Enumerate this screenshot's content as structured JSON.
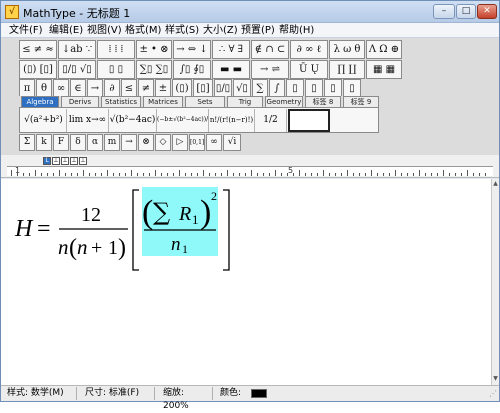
{
  "window": {
    "app_name": "MathType",
    "title_separator": " - ",
    "document_name": "无标题 1"
  },
  "window_buttons": {
    "minimize": "–",
    "maximize": "□",
    "close": "✕"
  },
  "menu": [
    {
      "label": "文件(F)"
    },
    {
      "label": "编辑(E)"
    },
    {
      "label": "视图(V)"
    },
    {
      "label": "格式(M)"
    },
    {
      "label": "样式(S)"
    },
    {
      "label": "大小(Z)"
    },
    {
      "label": "预置(P)"
    },
    {
      "label": "帮助(H)"
    }
  ],
  "palette_row1": [
    {
      "label": "≤ ≠ ≈"
    },
    {
      "label": "↓ab ∵"
    },
    {
      "label": "⁞ ⁞ ⁞"
    },
    {
      "label": "± • ⊗"
    },
    {
      "label": "→ ⇔ ↓"
    },
    {
      "label": "∴ ∀ ∃"
    },
    {
      "label": "∉ ∩ ⊂"
    },
    {
      "label": "∂ ∞ ℓ"
    },
    {
      "label": "λ ω θ"
    },
    {
      "label": "Λ Ω ⊕"
    }
  ],
  "palette_row2": [
    {
      "label": "(▯) [▯]"
    },
    {
      "label": "▯/▯ √▯"
    },
    {
      "label": "▯ ▯"
    },
    {
      "label": "∑▯ ∑▯"
    },
    {
      "label": "∫▯ ∮▯"
    },
    {
      "label": "▬ ▬"
    },
    {
      "label": "→ ⇌"
    },
    {
      "label": "Ū Ų"
    },
    {
      "label": "∏ ∐"
    },
    {
      "label": "▦ ▦"
    }
  ],
  "palette_row3": [
    {
      "label": "π"
    },
    {
      "label": "θ"
    },
    {
      "label": "∞"
    },
    {
      "label": "∈"
    },
    {
      "label": "→"
    },
    {
      "label": "∂"
    },
    {
      "label": "≤"
    },
    {
      "label": "≠"
    },
    {
      "label": "±"
    },
    {
      "label": "(▯)"
    },
    {
      "label": "[▯]"
    },
    {
      "label": "▯/▯"
    },
    {
      "label": "√▯"
    },
    {
      "label": "∑"
    },
    {
      "label": "∫"
    },
    {
      "label": "▯"
    },
    {
      "label": "▯"
    },
    {
      "label": "▯"
    },
    {
      "label": "▯"
    }
  ],
  "template_tabs": [
    {
      "label": "Algebra"
    },
    {
      "label": "Derivs"
    },
    {
      "label": "Statistics"
    },
    {
      "label": "Matrices"
    },
    {
      "label": "Sets"
    },
    {
      "label": "Trig"
    },
    {
      "label": "Geometry"
    },
    {
      "label": "标签 8"
    },
    {
      "label": "标签 9"
    }
  ],
  "templates": [
    {
      "label": "√(a²+b²)"
    },
    {
      "label": "lim x→∞"
    },
    {
      "label": "√(b²−4ac)"
    },
    {
      "label": "(−b±√(b²−4ac))/2a"
    },
    {
      "label": "n!/(r!(n−r)!)"
    },
    {
      "label": "1/2"
    },
    {
      "label": ""
    }
  ],
  "small_buttons": [
    {
      "label": "Σ"
    },
    {
      "label": "k"
    },
    {
      "label": "F"
    },
    {
      "label": "δ"
    },
    {
      "label": "α"
    },
    {
      "label": "m"
    },
    {
      "label": "→"
    },
    {
      "label": "⊗"
    },
    {
      "label": "◇"
    },
    {
      "label": "▷"
    },
    {
      "label": "[0,1]"
    },
    {
      "label": "∞"
    },
    {
      "label": "√i"
    }
  ],
  "ruler": {
    "marks": [
      "1",
      "5"
    ]
  },
  "ruler_tabs": [
    {
      "label": "L"
    },
    {
      "label": "⊥"
    },
    {
      "label": "⊥"
    },
    {
      "label": "⊥"
    },
    {
      "label": "⊥"
    }
  ],
  "equation": {
    "lhs": "H",
    "equals": "=",
    "numerator": "12",
    "den_n": "n",
    "den_paren_open": "(",
    "den_n2": "n",
    "den_plus": "+",
    "den_one": "1",
    "den_paren_close": ")",
    "sum_symbol": "∑",
    "sum_var": "R",
    "sum_sub": "1",
    "exponent": "2",
    "inner_den": "n",
    "inner_den_sub": "1",
    "highlight_color": "#8ff8f8"
  },
  "status": {
    "style": "样式: 数学(M)",
    "size": "尺寸: 标准(F)",
    "zoom": "缩放: 200%",
    "color_label": "颜色:",
    "color_value": "#000000"
  }
}
